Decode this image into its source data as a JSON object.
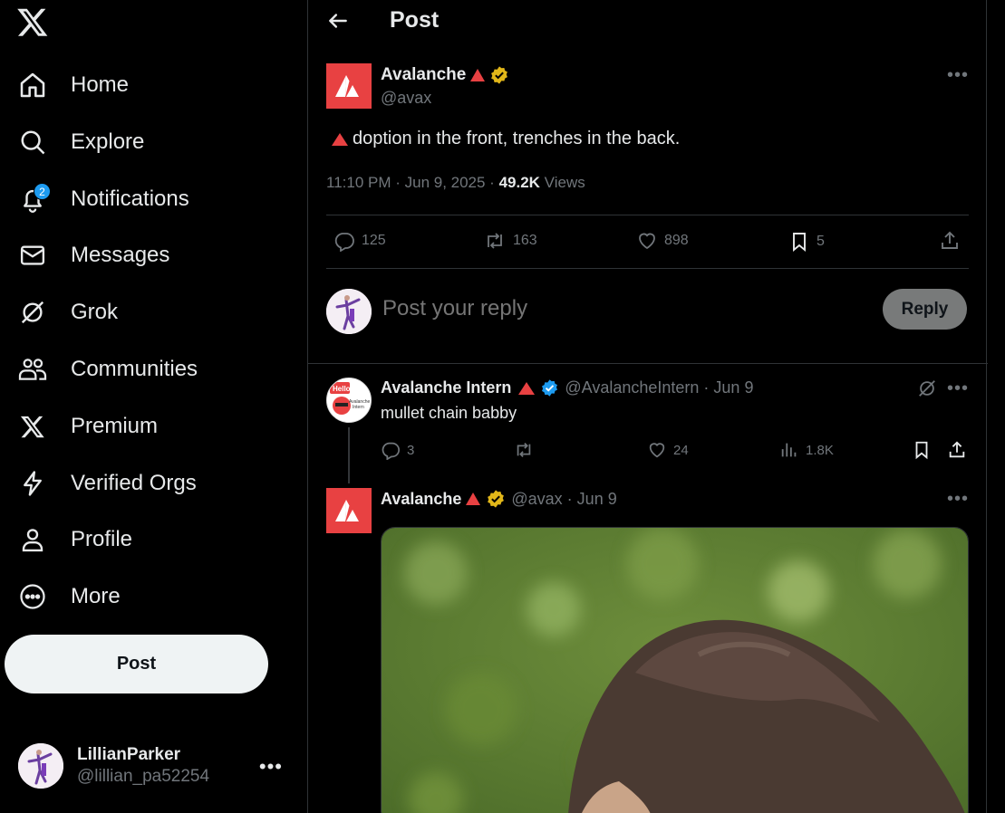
{
  "sidebar": {
    "nav": [
      {
        "label": "Home",
        "icon": "home-icon"
      },
      {
        "label": "Explore",
        "icon": "search-icon"
      },
      {
        "label": "Notifications",
        "icon": "bell-icon",
        "badge": "2"
      },
      {
        "label": "Messages",
        "icon": "envelope-icon"
      },
      {
        "label": "Grok",
        "icon": "grok-icon"
      },
      {
        "label": "Communities",
        "icon": "people-icon"
      },
      {
        "label": "Premium",
        "icon": "x-logo-icon"
      },
      {
        "label": "Verified Orgs",
        "icon": "lightning-icon"
      },
      {
        "label": "Profile",
        "icon": "person-icon"
      },
      {
        "label": "More",
        "icon": "more-circle-icon"
      }
    ],
    "post_label": "Post",
    "account": {
      "name": "LillianParker",
      "handle": "@lillian_pa52254"
    }
  },
  "header": {
    "title": "Post"
  },
  "post": {
    "author": "Avalanche",
    "handle": "@avax",
    "text": "doption in the front, trenches in the back.",
    "time": "11:10 PM · Jun 9, 2025 · ",
    "views_count": "49.2K",
    "views_label": " Views",
    "stats": {
      "replies": "125",
      "reposts": "163",
      "likes": "898",
      "bookmarks": "5"
    }
  },
  "reply_composer": {
    "placeholder": "Post your reply",
    "button": "Reply"
  },
  "replies": [
    {
      "author": "Avalanche Intern",
      "handle_time": "@AvalancheIntern · Jun 9",
      "text": "mullet chain babby",
      "stats": {
        "replies": "3",
        "likes": "24",
        "views": "1.8K"
      },
      "avatar_text": {
        "top": "Hello",
        "line1": "Avalanche",
        "line2": "Intern"
      }
    },
    {
      "author": "Avalanche",
      "handle_time": "@avax · Jun 9"
    }
  ],
  "colors": {
    "accent": "#1d9bf0",
    "brand_red": "#e84142",
    "gold_check": "#e2b719"
  }
}
